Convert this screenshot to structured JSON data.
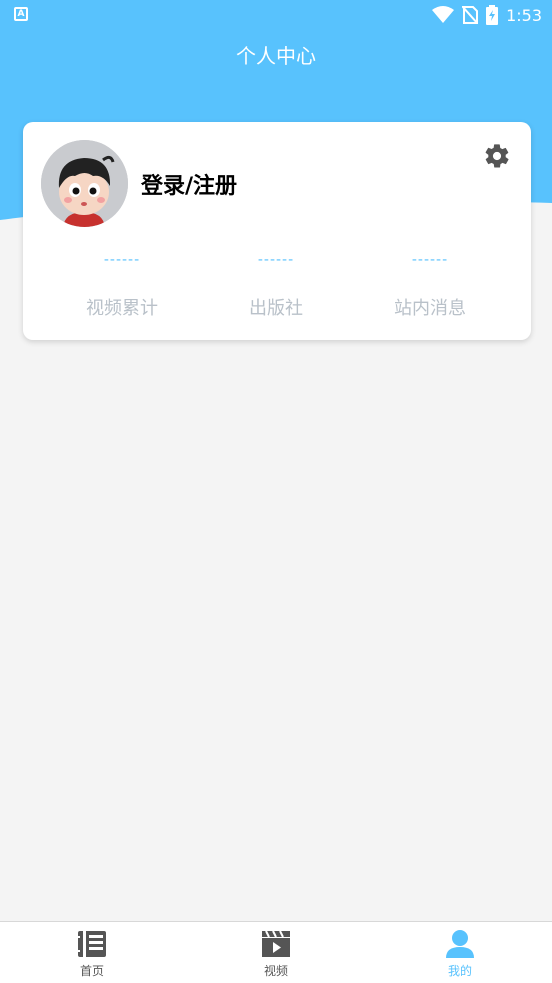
{
  "status_bar": {
    "indicator": "A",
    "time": "1:53"
  },
  "header": {
    "title": "个人中心"
  },
  "profile": {
    "login_label": "登录/注册",
    "avatar_icon": "cartoon-boy-avatar",
    "settings_icon": "gear-icon"
  },
  "stats": [
    {
      "value": "------",
      "label": "视频累计"
    },
    {
      "value": "------",
      "label": "出版社"
    },
    {
      "value": "------",
      "label": "站内消息"
    }
  ],
  "nav": {
    "items": [
      {
        "label": "首页",
        "icon": "home-book-icon"
      },
      {
        "label": "视频",
        "icon": "video-clapper-icon"
      },
      {
        "label": "我的",
        "icon": "person-icon",
        "active": true
      }
    ]
  },
  "colors": {
    "accent": "#58c2fd",
    "background": "#f4f4f4",
    "muted_text": "#b9c1c9"
  }
}
